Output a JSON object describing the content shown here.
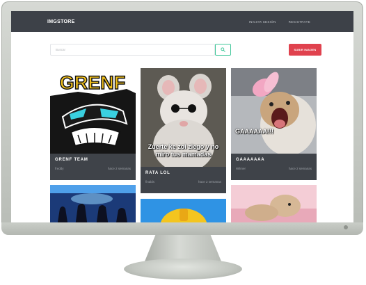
{
  "navbar": {
    "brand": "IMGSTORE",
    "links": [
      "INICIAR SESIÓN",
      "REGISTRATE"
    ]
  },
  "search": {
    "placeholder": "Buscar",
    "upload_label": "SUBIR IMAGEN"
  },
  "cards": [
    {
      "title": "GRENF TEAM",
      "user": "freddy",
      "time": "hace 2 semanas",
      "image_text": "GRENF"
    },
    {
      "title": "RATA LOL",
      "user": "finalds",
      "time": "hace 2 semanas",
      "image_text": "Zuerte ke zoi ziego y no miro tus mamadas"
    },
    {
      "title": "GAAAAAAA",
      "user": "Wilmer",
      "time": "hace 2 semanas",
      "image_text": "GAAAAAA!!!"
    }
  ],
  "colors": {
    "navbar": "#3d4148",
    "accent_green": "#41c79a",
    "upload_red": "#e0424e",
    "card_bg": "#3f4349"
  },
  "icons": {
    "search": "search-icon"
  }
}
